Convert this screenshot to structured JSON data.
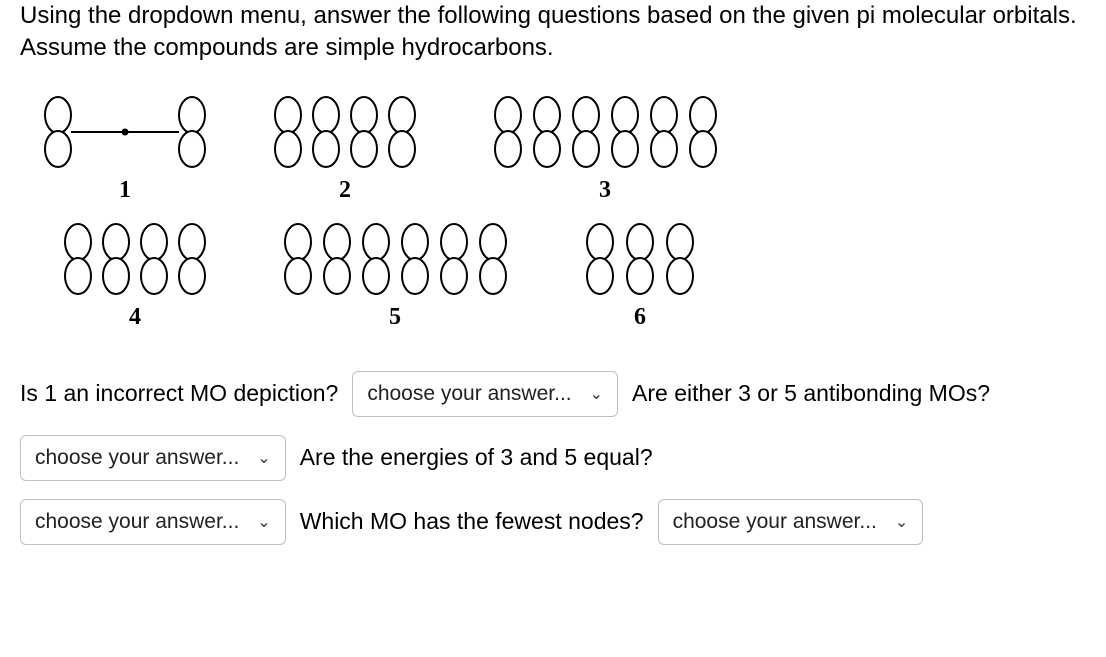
{
  "prompt": "Using the dropdown menu, answer the following questions based on the given pi molecular orbitals.  Assume the compounds are simple hydrocarbons.",
  "orbitals_row1": [
    {
      "label": "1",
      "lobes": 2,
      "arrangement": "separated"
    },
    {
      "label": "2",
      "lobes": 4,
      "arrangement": "contiguous"
    },
    {
      "label": "3",
      "lobes": 6,
      "arrangement": "contiguous"
    }
  ],
  "orbitals_row2": [
    {
      "label": "4",
      "lobes": 4,
      "arrangement": "contiguous"
    },
    {
      "label": "5",
      "lobes": 6,
      "arrangement": "contiguous"
    },
    {
      "label": "6",
      "lobes": 3,
      "arrangement": "contiguous"
    }
  ],
  "dropdown_placeholder": "choose your answer...",
  "questions": {
    "q1": "Is 1 an incorrect MO depiction?",
    "q2": "Are either 3 or 5 antibonding MOs?",
    "q3": "Are the energies of 3 and 5 equal?",
    "q4": "Which MO has the fewest nodes?"
  }
}
